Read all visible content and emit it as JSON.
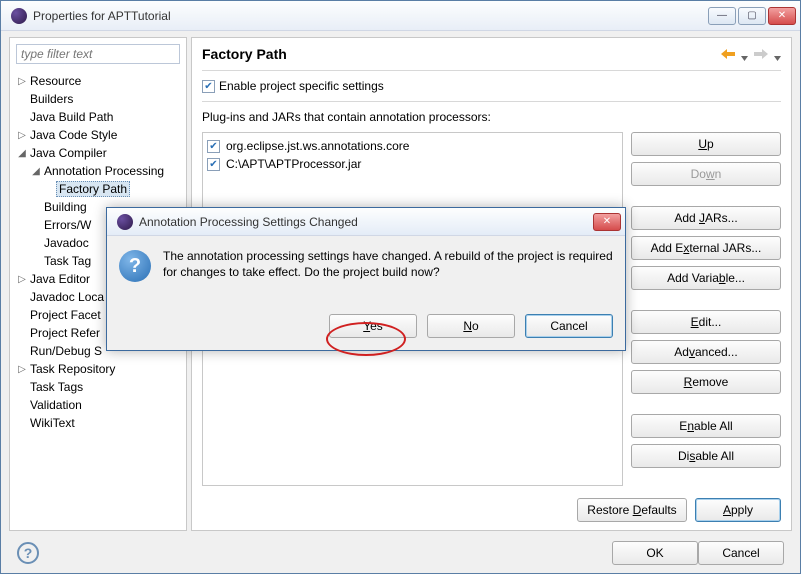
{
  "window": {
    "title": "Properties for APTTutorial"
  },
  "sidebar": {
    "filter_placeholder": "type filter text",
    "items": [
      {
        "label": "Resource",
        "tw": "▷",
        "indent": 0
      },
      {
        "label": "Builders",
        "tw": "",
        "indent": 0
      },
      {
        "label": "Java Build Path",
        "tw": "",
        "indent": 0
      },
      {
        "label": "Java Code Style",
        "tw": "▷",
        "indent": 0
      },
      {
        "label": "Java Compiler",
        "tw": "◢",
        "indent": 0
      },
      {
        "label": "Annotation Processing",
        "tw": "◢",
        "indent": 1
      },
      {
        "label": "Factory Path",
        "tw": "",
        "indent": 2,
        "selected": true
      },
      {
        "label": "Building",
        "tw": "",
        "indent": 1
      },
      {
        "label": "Errors/W",
        "tw": "",
        "indent": 1
      },
      {
        "label": "Javadoc",
        "tw": "",
        "indent": 1
      },
      {
        "label": "Task Tag",
        "tw": "",
        "indent": 1
      },
      {
        "label": "Java Editor",
        "tw": "▷",
        "indent": 0
      },
      {
        "label": "Javadoc Loca",
        "tw": "",
        "indent": 0
      },
      {
        "label": "Project Facet",
        "tw": "",
        "indent": 0
      },
      {
        "label": "Project Refer",
        "tw": "",
        "indent": 0
      },
      {
        "label": "Run/Debug S",
        "tw": "",
        "indent": 0
      },
      {
        "label": "Task Repository",
        "tw": "▷",
        "indent": 0
      },
      {
        "label": "Task Tags",
        "tw": "",
        "indent": 0
      },
      {
        "label": "Validation",
        "tw": "",
        "indent": 0
      },
      {
        "label": "WikiText",
        "tw": "",
        "indent": 0
      }
    ]
  },
  "main": {
    "heading": "Factory Path",
    "enable_label": "Enable project specific settings",
    "plugins_label": "Plug-ins and JARs that contain annotation processors:",
    "list": [
      "org.eclipse.jst.ws.annotations.core",
      "C:\\APT\\APTProcessor.jar"
    ],
    "buttons": {
      "up": "Up",
      "down": "Down",
      "add_jars": "Add JARs...",
      "add_ext": "Add External JARs...",
      "add_var": "Add Variable...",
      "edit": "Edit...",
      "advanced": "Advanced...",
      "remove": "Remove",
      "enable_all": "Enable All",
      "disable_all": "Disable All"
    },
    "restore": "Restore Defaults",
    "apply": "Apply"
  },
  "footer": {
    "ok": "OK",
    "cancel": "Cancel"
  },
  "modal": {
    "title": "Annotation Processing Settings Changed",
    "text": "The annotation processing settings have changed. A rebuild of the project is required for changes to take effect. Do the project build now?",
    "yes": "Yes",
    "no": "No",
    "cancel": "Cancel"
  }
}
